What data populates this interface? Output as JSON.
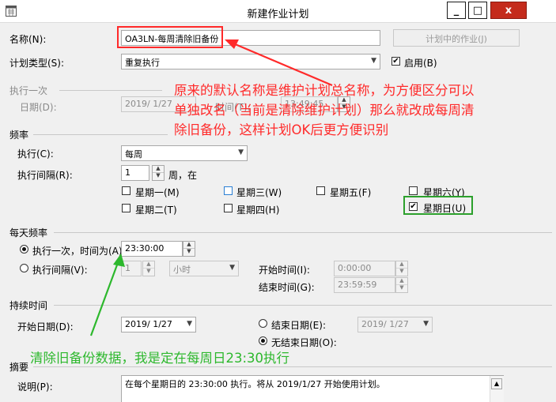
{
  "window": {
    "title": "新建作业计划",
    "min_label": "_",
    "max_label": "□",
    "close_label": "x"
  },
  "name": {
    "label": "名称(N):",
    "value": "OA3LN-每周清除旧备份",
    "jobs_button": "计划中的作业(J)"
  },
  "schedule_type": {
    "label": "计划类型(S):",
    "value": "重复执行",
    "enabled_label": "启用(B)",
    "enabled": true
  },
  "one_time": {
    "group": "执行一次",
    "date_label": "日期(D):",
    "date_value": "2019/ 1/27",
    "time_label": "时间(T):",
    "time_value": "13:49:45"
  },
  "frequency": {
    "group": "频率",
    "run_label": "执行(C):",
    "run_value": "每周",
    "interval_label": "执行间隔(R):",
    "interval_value": "1",
    "interval_unit": "周，在",
    "days": [
      {
        "label": "星期一(M)",
        "checked": false
      },
      {
        "label": "星期二(T)",
        "checked": false
      },
      {
        "label": "星期三(W)",
        "checked": false
      },
      {
        "label": "星期四(H)",
        "checked": false
      },
      {
        "label": "星期五(F)",
        "checked": false
      },
      {
        "label": "星期六(Y)",
        "checked": false
      },
      {
        "label": "星期日(U)",
        "checked": true
      }
    ]
  },
  "daily": {
    "group": "每天频率",
    "once_label": "执行一次，时间为(A):",
    "once_time": "23:30:00",
    "interval_label": "执行间隔(V):",
    "interval_value": "1",
    "interval_unit": "小时",
    "start_label": "开始时间(I):",
    "start_value": "0:00:00",
    "end_label": "结束时间(G):",
    "end_value": "23:59:59"
  },
  "duration": {
    "group": "持续时间",
    "start_label": "开始日期(D):",
    "start_value": "2019/ 1/27",
    "end_label": "结束日期(E):",
    "end_value": "2019/ 1/27",
    "noend_label": "无结束日期(O):"
  },
  "summary": {
    "group": "摘要",
    "desc_label": "说明(P):",
    "desc_value": "在每个星期日的 23:30:00 执行。将从 2019/1/27 开始使用计划。"
  },
  "annotations": {
    "red_lines": [
      "原来的默认名称是维护计划总名称，为方便区分可以",
      "单独改名（当前是清除维护计划）那么就改成每周清",
      "除旧备份，这样计划OK后更方便识别"
    ],
    "green": "清除旧备份数据，我是定在每周日23:30执行",
    "red_color": "#ff2a2a",
    "green_color": "#2db82d"
  }
}
